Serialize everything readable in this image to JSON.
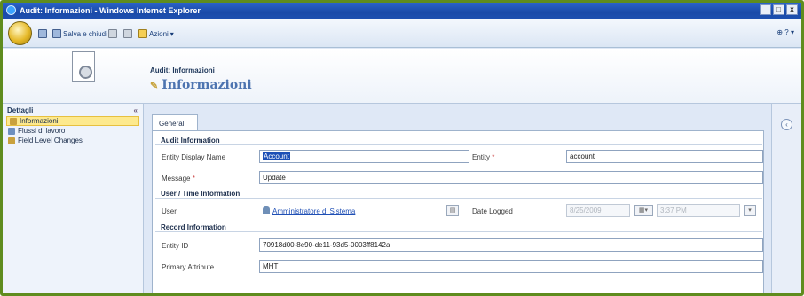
{
  "window": {
    "title": "Audit: Informazioni - Windows Internet Explorer",
    "buttons": [
      "_",
      "□",
      "x"
    ]
  },
  "toolbar": {
    "save_close_label": "Salva e chiudi",
    "actions_label": "Azioni",
    "help_label": "?"
  },
  "header": {
    "entity_label": "Audit: Informazioni",
    "title": "Informazioni"
  },
  "nav": {
    "heading": "Dettagli",
    "collapse": "«",
    "items": [
      {
        "label": "Informazioni",
        "active": true
      },
      {
        "label": "Flussi di lavoro",
        "active": false
      },
      {
        "label": "Field Level Changes",
        "active": false
      }
    ]
  },
  "form": {
    "tab": "General",
    "sections": {
      "audit": "Audit Information",
      "user_time": "User / Time Information",
      "record": "Record Information"
    },
    "labels": {
      "entity_display_name": "Entity Display Name",
      "entity": "Entity",
      "message": "Message",
      "user": "User",
      "date_logged": "Date Logged",
      "entity_id": "Entity ID",
      "primary_attribute": "Primary Attribute"
    },
    "required_mark": "*",
    "values": {
      "entity_display_name": "Account",
      "entity": "account",
      "message": "Update",
      "user": "Amministratore di Sistema",
      "date": "8/25/2009",
      "time": "3:37 PM",
      "entity_id": "70918d00-8e90-de11-93d5-0003ff8142a",
      "primary_attribute": "MHT"
    }
  }
}
